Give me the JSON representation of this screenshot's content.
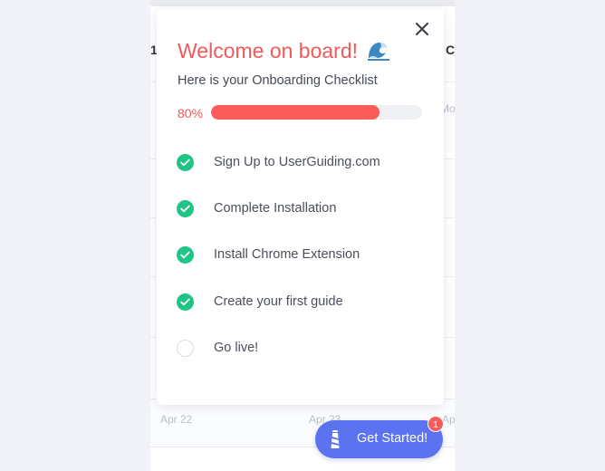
{
  "background": {
    "header_fragments": [
      "1",
      "C"
    ],
    "side_fragment": "Mo",
    "date_labels": [
      "Apr 22",
      "Apr 23",
      "Ap"
    ]
  },
  "modal": {
    "title": "Welcome on board!",
    "title_icon": "wave-icon",
    "subtitle": "Here is your Onboarding Checklist",
    "progress": {
      "label": "80%",
      "percent": 80
    },
    "tasks": [
      {
        "label": "Sign Up to UserGuiding.com",
        "done": true
      },
      {
        "label": "Complete Installation",
        "done": true
      },
      {
        "label": "Install Chrome Extension",
        "done": true
      },
      {
        "label": "Create your first guide",
        "done": true
      },
      {
        "label": "Go live!",
        "done": false
      }
    ]
  },
  "launcher": {
    "label": "Get Started!",
    "badge_count": "1",
    "icon": "lighthouse-icon"
  },
  "colors": {
    "accent_red": "#ef5959",
    "progress_fill": "#fb5b5b",
    "check_green": "#1ec585",
    "launcher_blue": "#5b73f0"
  }
}
